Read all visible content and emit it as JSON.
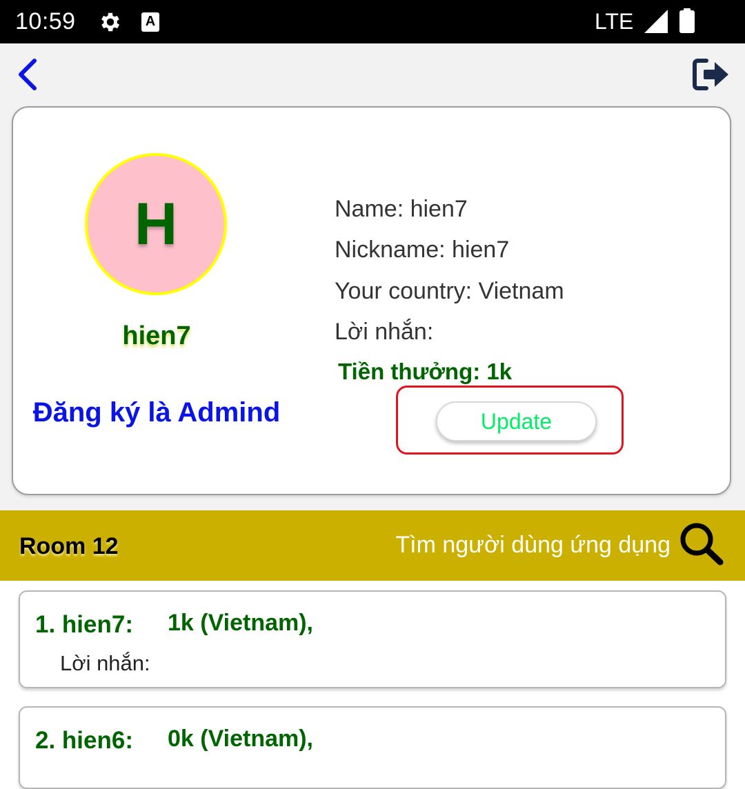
{
  "status_bar": {
    "time": "10:59",
    "network": "LTE",
    "icons": [
      "gear-icon",
      "a-icon",
      "signal-icon",
      "battery-icon"
    ]
  },
  "nav": {
    "back_icon": "chevron-left-icon",
    "logout_icon": "logout-icon"
  },
  "profile": {
    "avatar_letter": "H",
    "username": "hien7",
    "register_admin": "Đăng ký là Admind",
    "name_line": "Name: hien7",
    "nickname_line": "Nickname: hien7",
    "country_line": "Your country: Vietnam",
    "message_line": "Lời nhắn:",
    "reward_line": "Tiền thưởng: 1k",
    "update_label": "Update"
  },
  "room": {
    "title": "Room 12",
    "search_label": "Tìm người dùng ứng dụng"
  },
  "leaderboard": [
    {
      "rank": "1. hien7:",
      "score": "1k (Vietnam),",
      "message": "Lời nhắn:"
    },
    {
      "rank": "2. hien6:",
      "score": "0k (Vietnam),",
      "message": ""
    }
  ],
  "colors": {
    "green_text": "#006400",
    "blue_link": "#0a14e6",
    "room_bar": "#ccb000",
    "avatar_bg": "#fec0cb",
    "avatar_ring": "#ffff00",
    "update_text": "#00ee66",
    "highlight": "#e0141e"
  }
}
